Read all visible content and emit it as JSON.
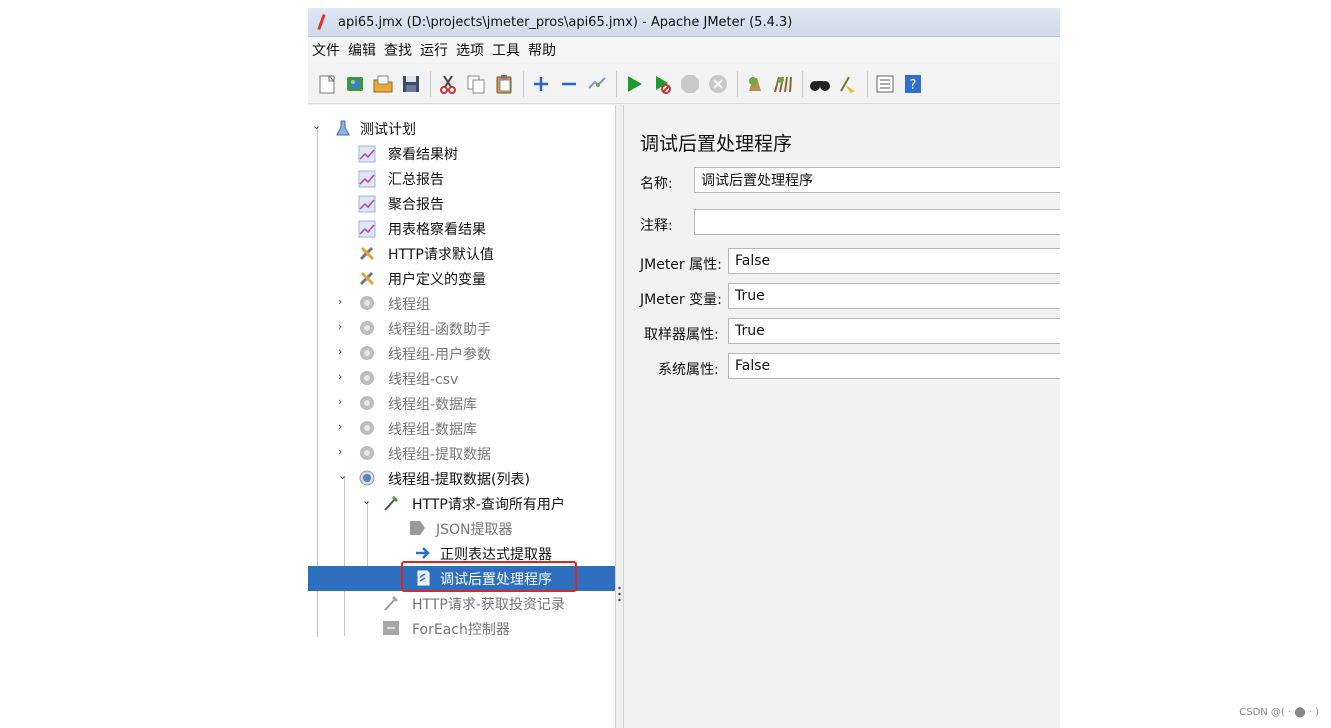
{
  "window": {
    "title": "api65.jmx (D:\\projects\\jmeter_pros\\api65.jmx) - Apache JMeter (5.4.3)"
  },
  "menubar": {
    "items": [
      "文件",
      "编辑",
      "查找",
      "运行",
      "选项",
      "工具",
      "帮助"
    ]
  },
  "toolbar": {
    "buttons": [
      "new-icon",
      "templates-icon",
      "open-icon",
      "save-icon",
      "cut-icon",
      "copy-icon",
      "paste-icon",
      "expand-icon",
      "collapse-icon",
      "toggle-icon",
      "start-icon",
      "start-no-timers-icon",
      "stop-icon",
      "shutdown-icon",
      "clear-icon",
      "clear-all-icon",
      "search-icon",
      "reset-search-icon",
      "function-helper-icon",
      "help-icon"
    ]
  },
  "tree": {
    "items": [
      {
        "label": "测试计划",
        "icon": "test-plan-icon",
        "expanded": true,
        "dim": false
      },
      {
        "label": "察看结果树",
        "icon": "listener-icon",
        "dim": false
      },
      {
        "label": "汇总报告",
        "icon": "listener-icon",
        "dim": false
      },
      {
        "label": "聚合报告",
        "icon": "listener-icon",
        "dim": false
      },
      {
        "label": "用表格察看结果",
        "icon": "listener-icon",
        "dim": false
      },
      {
        "label": "HTTP请求默认值",
        "icon": "config-element-icon",
        "dim": false
      },
      {
        "label": "用户定义的变量",
        "icon": "config-element-icon",
        "dim": false
      },
      {
        "label": "线程组",
        "icon": "thread-group-icon",
        "expanded": false,
        "dim": true
      },
      {
        "label": "线程组-函数助手",
        "icon": "thread-group-icon",
        "expanded": false,
        "dim": true
      },
      {
        "label": "线程组-用户参数",
        "icon": "thread-group-icon",
        "expanded": false,
        "dim": true
      },
      {
        "label": "线程组-csv",
        "icon": "thread-group-icon",
        "expanded": false,
        "dim": true
      },
      {
        "label": "线程组-数据库",
        "icon": "thread-group-icon",
        "expanded": false,
        "dim": true
      },
      {
        "label": "线程组-数据库",
        "icon": "thread-group-icon",
        "expanded": false,
        "dim": true
      },
      {
        "label": "线程组-提取数据",
        "icon": "thread-group-icon",
        "expanded": false,
        "dim": true
      },
      {
        "label": "线程组-提取数据(列表)",
        "icon": "thread-group-icon",
        "expanded": true,
        "dim": false
      },
      {
        "label": "HTTP请求-查询所有用户",
        "icon": "sampler-icon",
        "expanded": true,
        "dim": false
      },
      {
        "label": "JSON提取器",
        "icon": "json-extractor-icon",
        "dim": true
      },
      {
        "label": "正则表达式提取器",
        "icon": "regex-extractor-icon",
        "dim": false
      },
      {
        "label": "调试后置处理程序",
        "icon": "debug-postprocessor-icon",
        "dim": false,
        "selected": true
      },
      {
        "label": "HTTP请求-获取投资记录",
        "icon": "sampler-icon",
        "dim": true
      },
      {
        "label": "ForEach控制器",
        "icon": "foreach-controller-icon",
        "dim": true
      }
    ]
  },
  "detail": {
    "title": "调试后置处理程序",
    "name_label": "名称:",
    "name_value": "调试后置处理程序",
    "comment_label": "注释:",
    "comment_value": "",
    "fields": [
      {
        "label": "JMeter 属性:",
        "value": "False"
      },
      {
        "label": "JMeter 变量:",
        "value": "True"
      },
      {
        "label": "取样器属性:",
        "value": "True"
      },
      {
        "label": "系统属性:",
        "value": "False"
      }
    ]
  },
  "watermark": "CSDN @( · ⬤ · )",
  "colors": {
    "selection": "#2f6fc0",
    "highlight_border": "#e1271c"
  }
}
